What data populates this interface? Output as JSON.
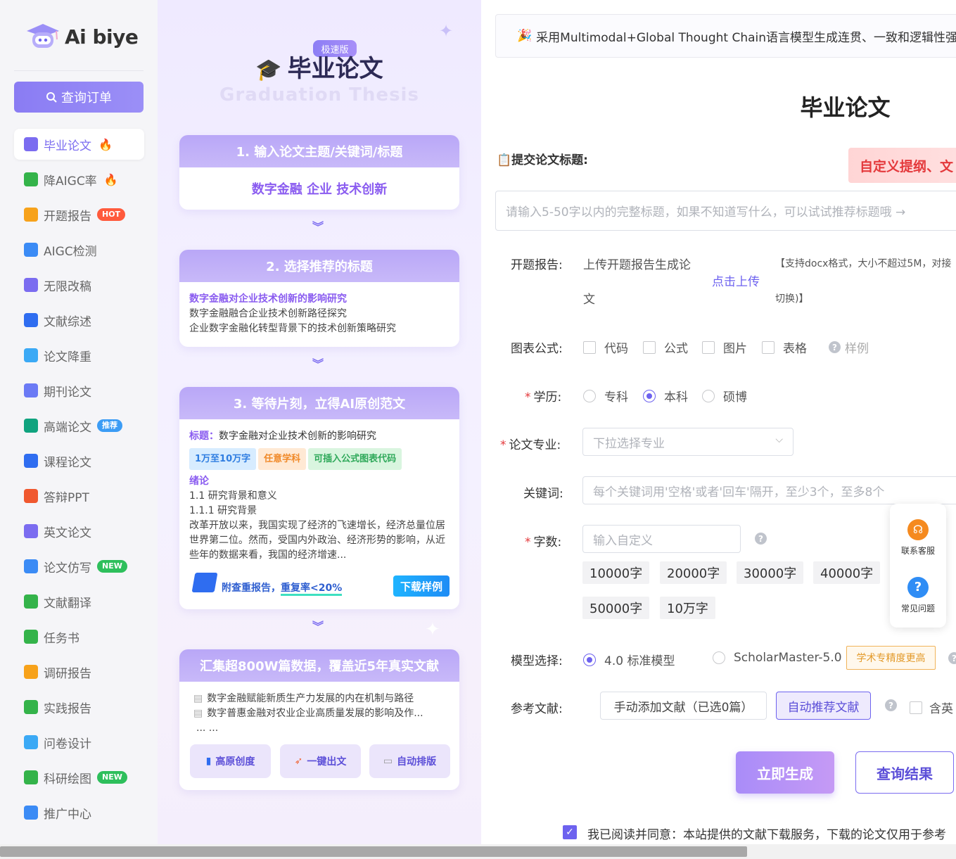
{
  "sidebar": {
    "logo_text": "Ai biye",
    "query_button": "查询订单",
    "items": [
      {
        "label": "毕业论文",
        "icon": "graduation-cap-icon",
        "color": "#7b6cf0",
        "extra": "fire"
      },
      {
        "label": "降AIGC率",
        "icon": "ai-icon",
        "color": "#34b34a",
        "extra": "fire"
      },
      {
        "label": "开题报告",
        "icon": "report-icon",
        "color": "#f7a21b",
        "badge": "HOT",
        "badge_color": "#ff5a3c"
      },
      {
        "label": "AIGC检测",
        "icon": "ai-detect-icon",
        "color": "#3b8bf5"
      },
      {
        "label": "无限改稿",
        "icon": "infinity-icon",
        "color": "#7b6cf0"
      },
      {
        "label": "文献综述",
        "icon": "book-icon",
        "color": "#2f6df0"
      },
      {
        "label": "论文降重",
        "icon": "chart-icon",
        "color": "#3ba9f5"
      },
      {
        "label": "期刊论文",
        "icon": "journal-icon",
        "color": "#6b7af5"
      },
      {
        "label": "高端论文",
        "icon": "openai-icon",
        "color": "#10a37f",
        "badge": "推荐",
        "badge_color": "#3b9cf5"
      },
      {
        "label": "课程论文",
        "icon": "notebook-icon",
        "color": "#2f6df0"
      },
      {
        "label": "答辩PPT",
        "icon": "ppt-icon",
        "color": "#f0582f"
      },
      {
        "label": "英文论文",
        "icon": "graduation-cap-icon",
        "color": "#7b6cf0"
      },
      {
        "label": "论文仿写",
        "icon": "edit-icon",
        "color": "#3b8bf5",
        "badge": "NEW",
        "badge_color": "#2ebf5c"
      },
      {
        "label": "文献翻译",
        "icon": "translate-icon",
        "color": "#34b34a"
      },
      {
        "label": "任务书",
        "icon": "task-icon",
        "color": "#34b34a"
      },
      {
        "label": "调研报告",
        "icon": "survey-icon",
        "color": "#f7a21b"
      },
      {
        "label": "实践报告",
        "icon": "practice-icon",
        "color": "#34b34a"
      },
      {
        "label": "问卷设计",
        "icon": "questionnaire-icon",
        "color": "#3ba9f5"
      },
      {
        "label": "科研绘图",
        "icon": "image-icon",
        "color": "#34b34a",
        "badge": "NEW",
        "badge_color": "#2ebf5c"
      },
      {
        "label": "推广中心",
        "icon": "send-icon",
        "color": "#3b8bf5"
      }
    ]
  },
  "promo": {
    "speed_tag": "极速版",
    "title": "毕业论文",
    "watermark": "Graduation Thesis",
    "step1": {
      "head": "1. 输入论文主题/关键词/标题",
      "body": "数字金融 企业 技术创新"
    },
    "step2": {
      "head": "2. 选择推荐的标题",
      "titles": [
        "数字金融对企业技术创新的影响研究",
        "数字金融融合企业技术创新路径探究",
        "企业数字金融化转型背景下的技术创新策略研究"
      ]
    },
    "step3": {
      "head": "3. 等待片刻，立得AI原创范文",
      "title_label": "标题：",
      "title_value": "数字金融对企业技术创新的影响研究",
      "chips": [
        "1万至10万字",
        "任意学科",
        "可插入公式图表代码"
      ],
      "section": "绪论",
      "lines": [
        "1.1 研究背景和意义",
        "1.1.1 研究背景",
        "改革开放以来，我国实现了经济的飞速增长，经济总量位居世界第二位。然而，受国内外政治、经济形势的影响，从近些年的数据来看，我国的经济增速..."
      ],
      "report_text_a": "附查重报告，",
      "report_text_b": "重复率<20%",
      "download": "下载样例"
    },
    "step4": {
      "head": "汇集超800W篇数据，覆盖近5年真实文献",
      "items": [
        "数字金融赋能新质生产力发展的内在机制与路径",
        "数字普惠金融对农业企业高质量发展的影响及作..."
      ],
      "ellipsis": "... ...",
      "features": [
        "高原创度",
        "一键出文",
        "自动排版"
      ]
    }
  },
  "main": {
    "notice": "采用Multimodal+Global Thought Chain语言模型生成连贯、一致和逻辑性强的",
    "title": "毕业论文",
    "submit_label": "提交论文标题:",
    "custom_button": "自定义提纲、文",
    "title_placeholder": "请输入5-50字以内的完整标题，如果不知道写什么，可以试试推荐标题哦 →",
    "proposal": {
      "label": "开题报告:",
      "text_a": "上传开题报告生成论",
      "text_b": "文",
      "upload": "点击上传",
      "hint_a": "【支持docx格式，大小不超过5M，对接",
      "hint_b": "切换)】"
    },
    "charts": {
      "label": "图表公式:",
      "options": [
        "代码",
        "公式",
        "图片",
        "表格"
      ],
      "sample": "样例"
    },
    "education": {
      "label": "学历:",
      "options": [
        "专科",
        "本科",
        "硕博"
      ],
      "selected": "本科"
    },
    "major": {
      "label": "论文专业:",
      "placeholder": "下拉选择专业"
    },
    "keywords": {
      "label": "关键词:",
      "placeholder": "每个关键词用'空格'或者'回车'隔开，至少3个，至多8个"
    },
    "wordcount": {
      "label": "字数:",
      "placeholder": "输入自定义",
      "chips": [
        "10000字",
        "20000字",
        "30000字",
        "40000字",
        "50000字",
        "10万字"
      ]
    },
    "model": {
      "label": "模型选择:",
      "options": [
        "4.0 标准模型",
        "ScholarMaster-5.0"
      ],
      "selected": "4.0 标准模型",
      "tag": "学术专精度更高"
    },
    "refs": {
      "label": "参考文献:",
      "manual": "手动添加文献（已选0篇）",
      "auto": "自动推荐文献",
      "english": "含英"
    },
    "generate": "立即生成",
    "query": "查询结果",
    "agreement": "我已阅读并同意：本站提供的文献下载服务，下载的论文仅用于参考",
    "float": {
      "service": "联系客服",
      "faq": "常见问题"
    }
  }
}
